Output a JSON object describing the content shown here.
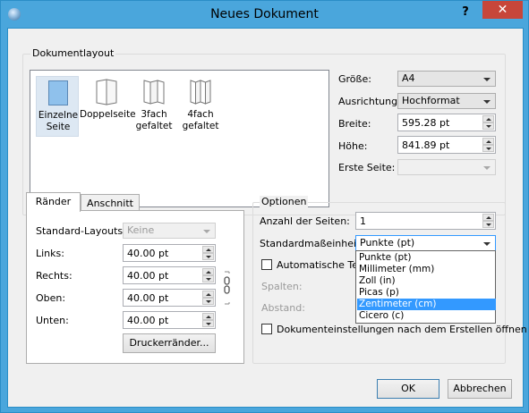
{
  "window": {
    "title": "Neues Dokument",
    "help": "?",
    "close": "✕"
  },
  "layout_group": {
    "label": "Dokumentlayout",
    "items": [
      {
        "label1": "Einzelne",
        "label2": "Seite",
        "selected": true
      },
      {
        "label1": "Doppelseite",
        "label2": "",
        "selected": false
      },
      {
        "label1": "3fach",
        "label2": "gefaltet",
        "selected": false
      },
      {
        "label1": "4fach",
        "label2": "gefaltet",
        "selected": false
      }
    ]
  },
  "size_fields": {
    "groesse_label": "Größe:",
    "groesse_value": "A4",
    "ausrichtung_label": "Ausrichtung:",
    "ausrichtung_value": "Hochformat",
    "breite_label": "Breite:",
    "breite_value": "595.28 pt",
    "hoehe_label": "Höhe:",
    "hoehe_value": "841.89 pt",
    "erste_seite_label": "Erste Seite:",
    "erste_seite_value": ""
  },
  "tabs": {
    "raender": "Ränder",
    "anschnitt": "Anschnitt"
  },
  "margins": {
    "standard_layouts_label": "Standard-Layouts:",
    "standard_layouts_value": "Keine",
    "links_label": "Links:",
    "links_value": "40.00 pt",
    "rechts_label": "Rechts:",
    "rechts_value": "40.00 pt",
    "oben_label": "Oben:",
    "oben_value": "40.00 pt",
    "unten_label": "Unten:",
    "unten_value": "40.00 pt",
    "printer_button": "Druckerränder..."
  },
  "options": {
    "label": "Optionen",
    "anzahl_label": "Anzahl der Seiten:",
    "anzahl_value": "1",
    "mass_label": "Standardmaßeinheit:",
    "mass_value": "Punkte (pt)",
    "auto_text_label": "Automatische Text",
    "spalten_label": "Spalten:",
    "abstand_label": "Abstand:",
    "open_settings_label": "Dokumenteinstellungen nach dem Erstellen öffnen",
    "unit_options": [
      "Punkte (pt)",
      "Millimeter (mm)",
      "Zoll (in)",
      "Picas (p)",
      "Zentimeter (cm)",
      "Cicero (c)"
    ],
    "highlighted_option_index": 4
  },
  "buttons": {
    "ok": "OK",
    "cancel": "Abbrechen"
  },
  "colors": {
    "titlebar": "#4aa6dc",
    "close": "#c7463a",
    "selection": "#3399ff"
  }
}
